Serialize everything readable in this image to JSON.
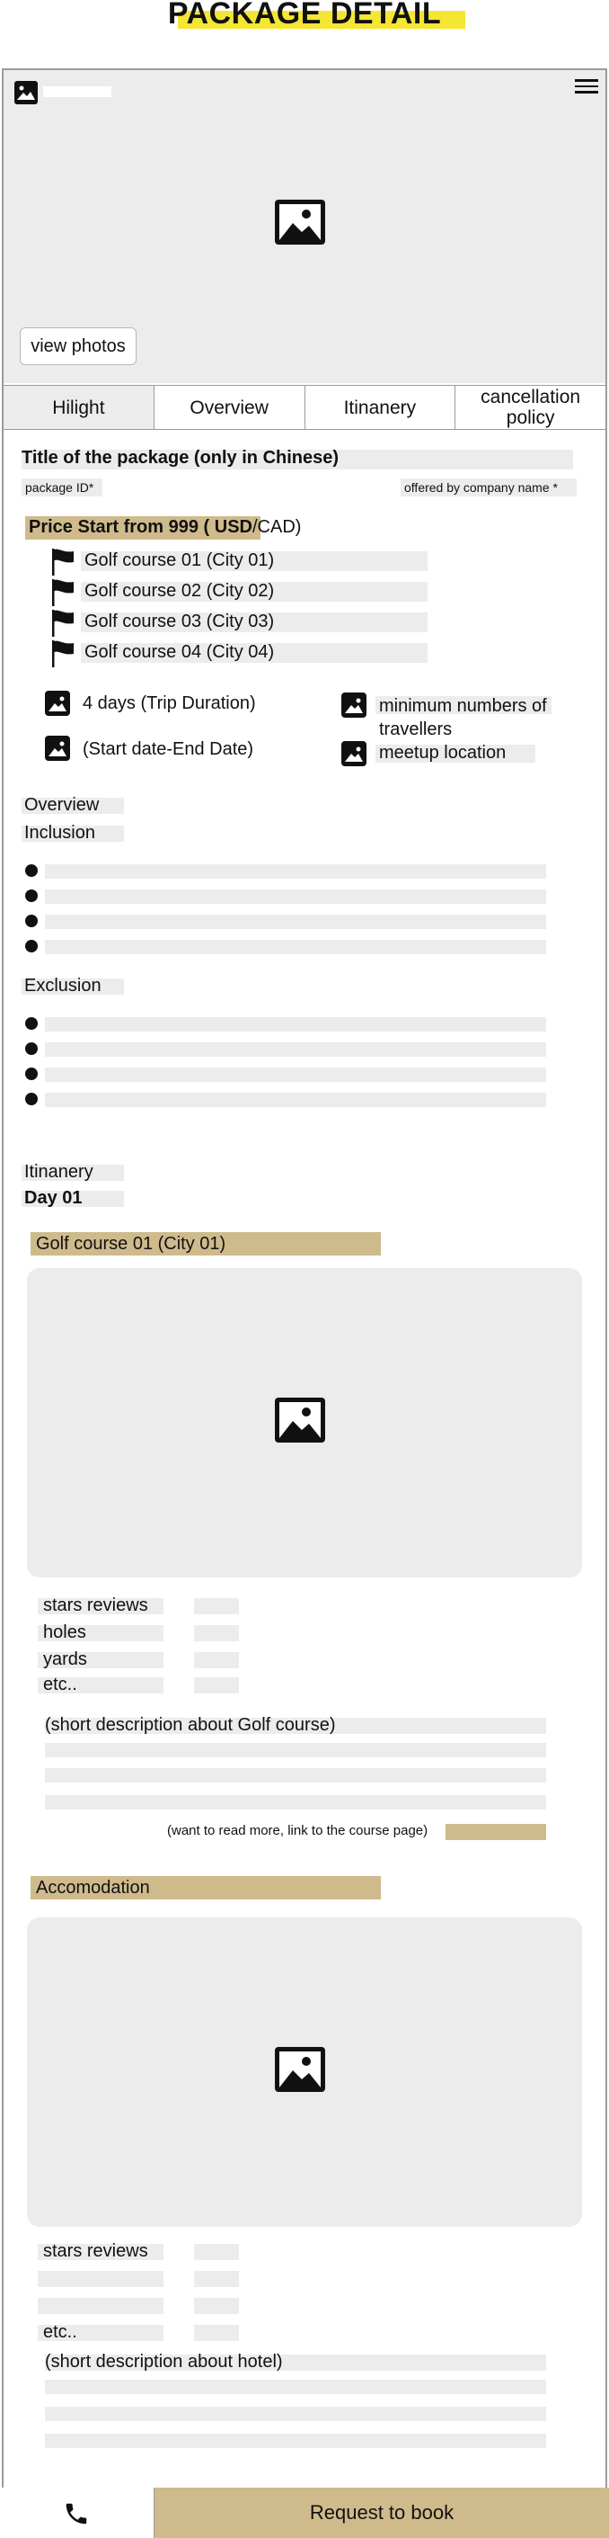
{
  "page": {
    "title": "PACKAGE DETAIL"
  },
  "hero": {
    "view_photos_label": "view photos",
    "image_icon": "image-icon",
    "menu_icon": "hamburger-icon"
  },
  "tabs": [
    {
      "label": "Hilight",
      "active": true
    },
    {
      "label": "Overview",
      "active": false
    },
    {
      "label": "Itinanery",
      "active": false
    },
    {
      "label": "cancellation policy",
      "active": false
    }
  ],
  "package": {
    "title": "Title of the package (only in Chinese)",
    "id_label": "package ID*",
    "company_label": "offered by company name *",
    "price_main": "Price Start from 999 ( USD",
    "price_tail": "/CAD)"
  },
  "courses": [
    "Golf course 01 (City 01)",
    "Golf course 02 (City 02)",
    "Golf course 03 (City 03)",
    "Golf course 04 (City 04)"
  ],
  "info": {
    "duration": "4 days (Trip Duration)",
    "dates": "(Start date-End Date)",
    "min_travellers": "minimum numbers of travellers",
    "meetup": "meetup location"
  },
  "sections": {
    "overview": "Overview",
    "inclusion": "Inclusion",
    "exclusion": "Exclusion",
    "itinerary": "Itinanery",
    "day": "Day 01"
  },
  "golf": {
    "heading": "Golf course 01 (City 01)",
    "stats": [
      "stars reviews",
      "holes",
      "yards",
      "etc.."
    ],
    "description": "(short description about Golf course)",
    "read_more": "(want to read more, link to the course page)"
  },
  "hotel": {
    "heading": "Accomodation",
    "stats": [
      "stars reviews",
      "",
      "",
      "etc.."
    ],
    "description": "(short description about hotel)"
  },
  "bottom": {
    "book_label": "Request to book",
    "call_icon": "phone-icon"
  },
  "colors": {
    "accent_gold": "#cfba8c",
    "title_highlight": "#f5e633",
    "placeholder_gray": "#ececec"
  }
}
